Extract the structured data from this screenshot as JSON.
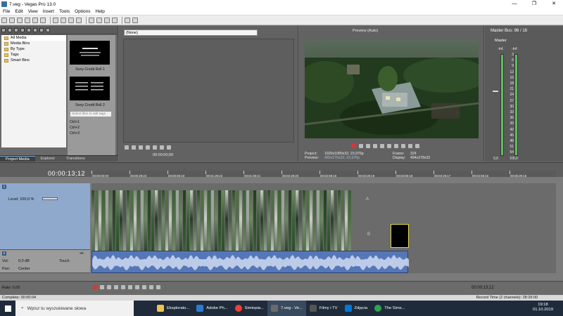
{
  "window": {
    "title": "7.veg - Vegas Pro 13.0",
    "minimize": "—",
    "maximize": "❐",
    "close": "✕"
  },
  "menu": [
    "File",
    "Edit",
    "View",
    "Insert",
    "Tools",
    "Options",
    "Help"
  ],
  "project_media": {
    "tree": [
      "All Media",
      "Media Bins",
      "By Type",
      "Tags",
      "Smart Bins"
    ],
    "thumbnails": [
      "Sony Credit Roll 1",
      "Sony Credit Roll 2"
    ],
    "tags_placeholder": "Select files to edit tags",
    "shortcuts": [
      "Ctrl+1",
      "Ctrl+2",
      "Ctrl+3"
    ],
    "tabs": [
      "Project Media",
      "Explorer",
      "Transitions"
    ]
  },
  "trimmer": {
    "selector": "(None)",
    "time": "00:00:00;00"
  },
  "preview": {
    "mode": "Preview (Auto)",
    "project_label": "Project:",
    "project_value": "1920x1080x32; 23,976p",
    "preview_label": "Preview:",
    "preview_value": "480x270x32; 23,976p",
    "frame_label": "Frame:",
    "frame_value": "324",
    "display_label": "Display:",
    "display_value": "494x278x32"
  },
  "master_bus": {
    "title": "Master Bus: 96 / 16",
    "channel": "Master",
    "peak_left": "-Inf.",
    "peak_right": "-Inf.",
    "scale": [
      "3",
      "6",
      "9",
      "12",
      "15",
      "18",
      "21",
      "24",
      "27",
      "30",
      "33",
      "36",
      "39",
      "42",
      "45",
      "48",
      "51",
      "54",
      "57"
    ],
    "level_left": "0,0",
    "level_right": "0,0"
  },
  "timeline": {
    "timecode": "00:00:13;12",
    "ruler": [
      "00:00:00;00",
      "00:00:29;23",
      "00:00:59;23",
      "00:01:29;22",
      "00:01:59;21",
      "00:02:29;20",
      "00:02:59;19",
      "00:03:29;19",
      "00:03:59;18",
      "00:04:29;17",
      "00:04:59;16",
      "00:05:29;16"
    ],
    "video_track": {
      "number": "1",
      "level_label": "Level: 100,0 %"
    },
    "audio_track": {
      "number": "2",
      "vol_label": "Vol:",
      "vol_value": "0,0 dB",
      "pan_label": "Pan:",
      "pan_value": "Center",
      "mode": "Touch",
      "peak": "-Inf."
    },
    "fade_a": "A",
    "fade_b": "B"
  },
  "transport": {
    "rate": "Rate: 0,00",
    "end_time": "00:00:13;12"
  },
  "status": {
    "left": "Complete: 00:00:04",
    "right": "Record Time (2 channels): 28:29:00"
  },
  "taskbar": {
    "search_placeholder": "Wpisz tu wyszukiwane słowa",
    "items": [
      "Eksplorato...",
      "Adobe Ph...",
      "Simtopia...",
      "7.veg - Ve...",
      "Filmy i TV",
      "Zdjęcia",
      "The Sims..."
    ],
    "time": "19:18",
    "date": "01.10.2019"
  },
  "colors": {
    "accent": "#7ea7d9",
    "taskbar": "#1f2b3a",
    "audio_clip": "#5577b8",
    "video_track_header": "#8fa9cc"
  }
}
